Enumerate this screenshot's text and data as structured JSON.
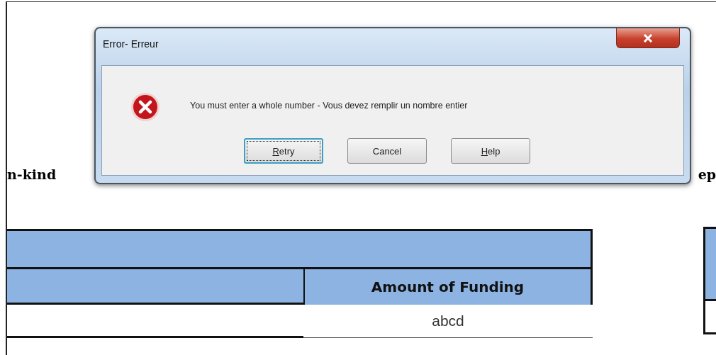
{
  "document": {
    "headings": [
      "n-kind",
      "ep"
    ],
    "table": {
      "column_2_header": "Amount of Funding",
      "rows": [
        {
          "column_2": "abcd"
        }
      ]
    }
  },
  "dialog": {
    "title": "Error- Erreur",
    "message": "You must enter a whole number - Vous devez remplir un nombre entier",
    "buttons": [
      {
        "label": "Retry",
        "first_letter_underlined": true,
        "focused": true
      },
      {
        "label": "Cancel",
        "first_letter_underlined": false,
        "focused": false
      },
      {
        "label": "Help",
        "first_letter_underlined": true,
        "focused": false
      }
    ]
  }
}
